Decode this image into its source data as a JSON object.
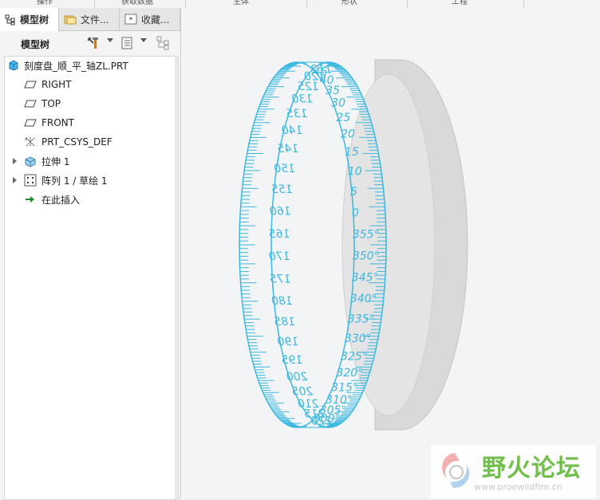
{
  "topbar": {
    "labels": [
      "操作",
      "获取数据",
      "主体",
      "形状",
      "工程"
    ]
  },
  "tabs": [
    {
      "label": "模型树",
      "icon": "model-tree-icon"
    },
    {
      "label": "文件...",
      "icon": "folder-icon"
    },
    {
      "label": "收藏...",
      "icon": "favorites-icon"
    }
  ],
  "toolbar": {
    "title": "模型树",
    "settings_icon": "settings-tools-icon",
    "show_icon": "show-list-icon",
    "filter_icon": "tree-filter-icon"
  },
  "tree": {
    "root": "刻度盘_顺_平_轴ZL.PRT",
    "items": [
      "RIGHT",
      "TOP",
      "FRONT",
      "PRT_CSYS_DEF",
      "拉伸 1",
      "阵列 1 / 草绘 1",
      "在此插入"
    ]
  },
  "model": {
    "name": "graduated-ring",
    "color_scale": "#3ab8e0",
    "color_body": "#d9d9d9",
    "front_labels": [
      "45",
      "40",
      "35",
      "30",
      "25",
      "20",
      "15",
      "10",
      "5",
      "0",
      "355°",
      "350°",
      "345°",
      "340°",
      "335°",
      "330°",
      "325°",
      "320°",
      "315°",
      "310°",
      "305°",
      "300°"
    ],
    "back_labels": [
      "112",
      "120",
      "125",
      "130",
      "135",
      "140",
      "145",
      "150",
      "155",
      "160",
      "165",
      "170",
      "175",
      "180",
      "185",
      "190",
      "195",
      "200",
      "205",
      "210",
      "215",
      "220"
    ]
  },
  "watermark": {
    "title": "野火论坛",
    "url": "www.proewildfire.cn"
  }
}
